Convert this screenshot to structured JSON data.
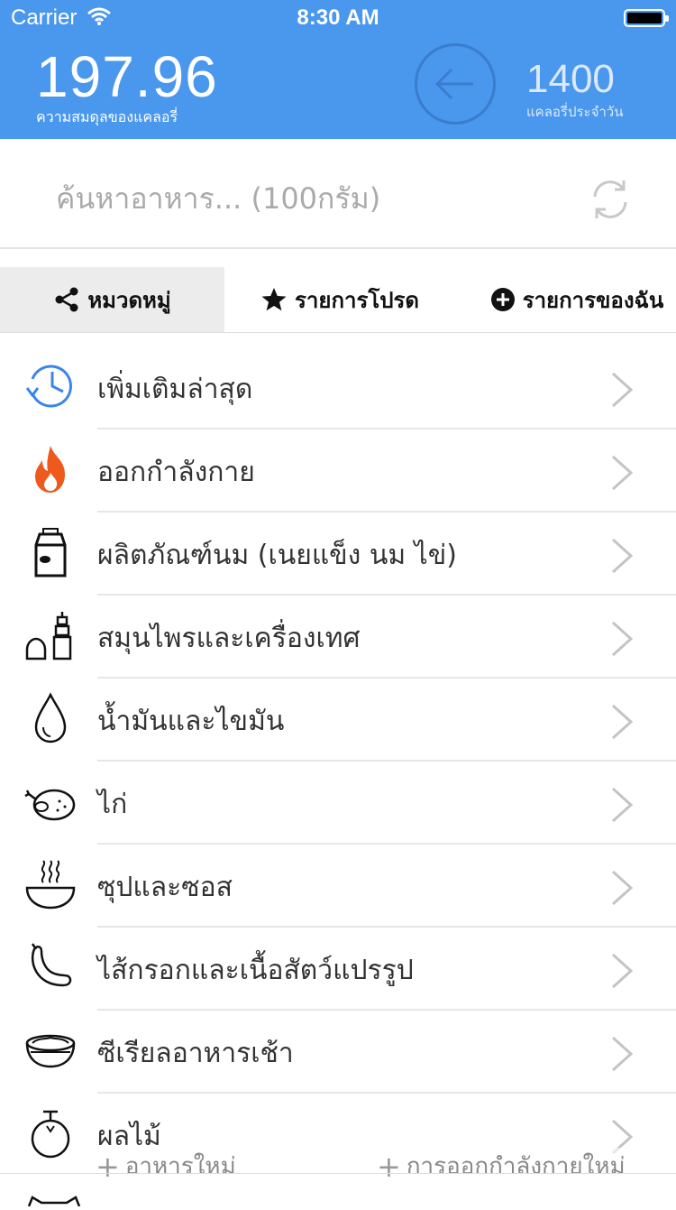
{
  "status": {
    "carrier": "Carrier",
    "time": "8:30 AM"
  },
  "header": {
    "balance_value": "197.96",
    "balance_label": "ความสมดุลของแคลอรี่",
    "daily_value": "1400",
    "daily_label": "แคลอรี่ประจำวัน"
  },
  "search": {
    "placeholder": "ค้นหาอาหาร... (100กรัม)"
  },
  "tabs": [
    {
      "label": "หมวดหมู่",
      "icon": "share-icon",
      "active": true
    },
    {
      "label": "รายการโปรด",
      "icon": "star-icon",
      "active": false
    },
    {
      "label": "รายการของฉัน",
      "icon": "plus-circle-icon",
      "active": false
    }
  ],
  "categories": [
    {
      "label": "เพิ่มเติมล่าสุด",
      "icon": "recent-clock-icon"
    },
    {
      "label": "ออกกำลังกาย",
      "icon": "fire-icon"
    },
    {
      "label": "ผลิตภัณฑ์นม (เนยแข็ง นม ไข่)",
      "icon": "milk-carton-icon"
    },
    {
      "label": "สมุนไพรและเครื่องเทศ",
      "icon": "spice-mill-icon"
    },
    {
      "label": "น้ำมันและไขมัน",
      "icon": "oil-drop-icon"
    },
    {
      "label": "ไก่",
      "icon": "chicken-icon"
    },
    {
      "label": "ซุปและซอส",
      "icon": "soup-bowl-icon"
    },
    {
      "label": "ไส้กรอกและเนื้อสัตว์แปรรูป",
      "icon": "sausage-icon"
    },
    {
      "label": "ซีเรียลอาหารเช้า",
      "icon": "cereal-bowl-icon"
    },
    {
      "label": "ผลไม้",
      "icon": "fruit-icon"
    }
  ],
  "bottom": {
    "new_food": "อาหารใหม่",
    "new_exercise": "การออกกำลังกายใหม่"
  },
  "colors": {
    "header_bg": "#4a97ee",
    "recent_icon": "#3a86e8",
    "fire_icon": "#ee5a1e"
  }
}
